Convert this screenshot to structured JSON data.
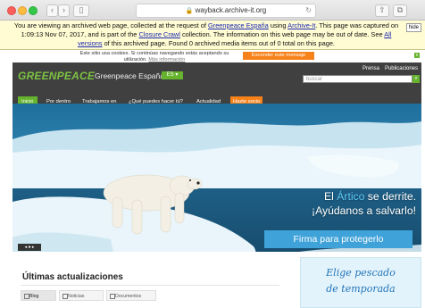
{
  "browser": {
    "url": "wayback.archive-it.org",
    "back_icon": "chevron-left-icon",
    "forward_icon": "chevron-right-icon"
  },
  "wayback": {
    "part1": "You are viewing an archived web page, collected at the request of ",
    "link1": "Greenpeace España",
    "part2": " using ",
    "link2": "Archive-It",
    "part3": ". This page was captured on 1:09:13 Nov 07, 2017, and is part of the ",
    "link3": "Closure Crawl",
    "part4": " collection. The information on this web page may be out of date. See ",
    "link4": "All versions",
    "part5": " of this archived page. Found 0 archived media items out of 0 total on this page.",
    "hide_label": "hide"
  },
  "cookie": {
    "message": "Este sitio usa cookies. Si continúas navegando estás aceptando su utilización.",
    "more": "Más información",
    "hide_button": "Esconder este mensaje",
    "close": "x"
  },
  "header": {
    "logo": "GREENPEACE",
    "country": "Greenpeace España",
    "country_tag": "ES ▾",
    "links": [
      "Prensa",
      "Publicaciones"
    ],
    "search_placeholder": "buscar",
    "nav": [
      "Inicio",
      "Por dentro",
      "Trabajamos en",
      "¿Qué puedes hacer tú?",
      "Actualidad",
      "Hazte socio"
    ]
  },
  "hero": {
    "line1_a": "El ",
    "line1_accent": "Ártico",
    "line1_b": " se derrite.",
    "line2": "¡Ayúdanos a salvarlo!",
    "button": "Firma para protegerlo",
    "slider": "◂ ● ▸"
  },
  "updates": {
    "title": "Últimas actualizaciones",
    "tabs": [
      "Blog",
      "Noticias",
      "Documentos"
    ]
  },
  "promo": {
    "line1": "Elige pescado",
    "line2": "de temporada"
  }
}
